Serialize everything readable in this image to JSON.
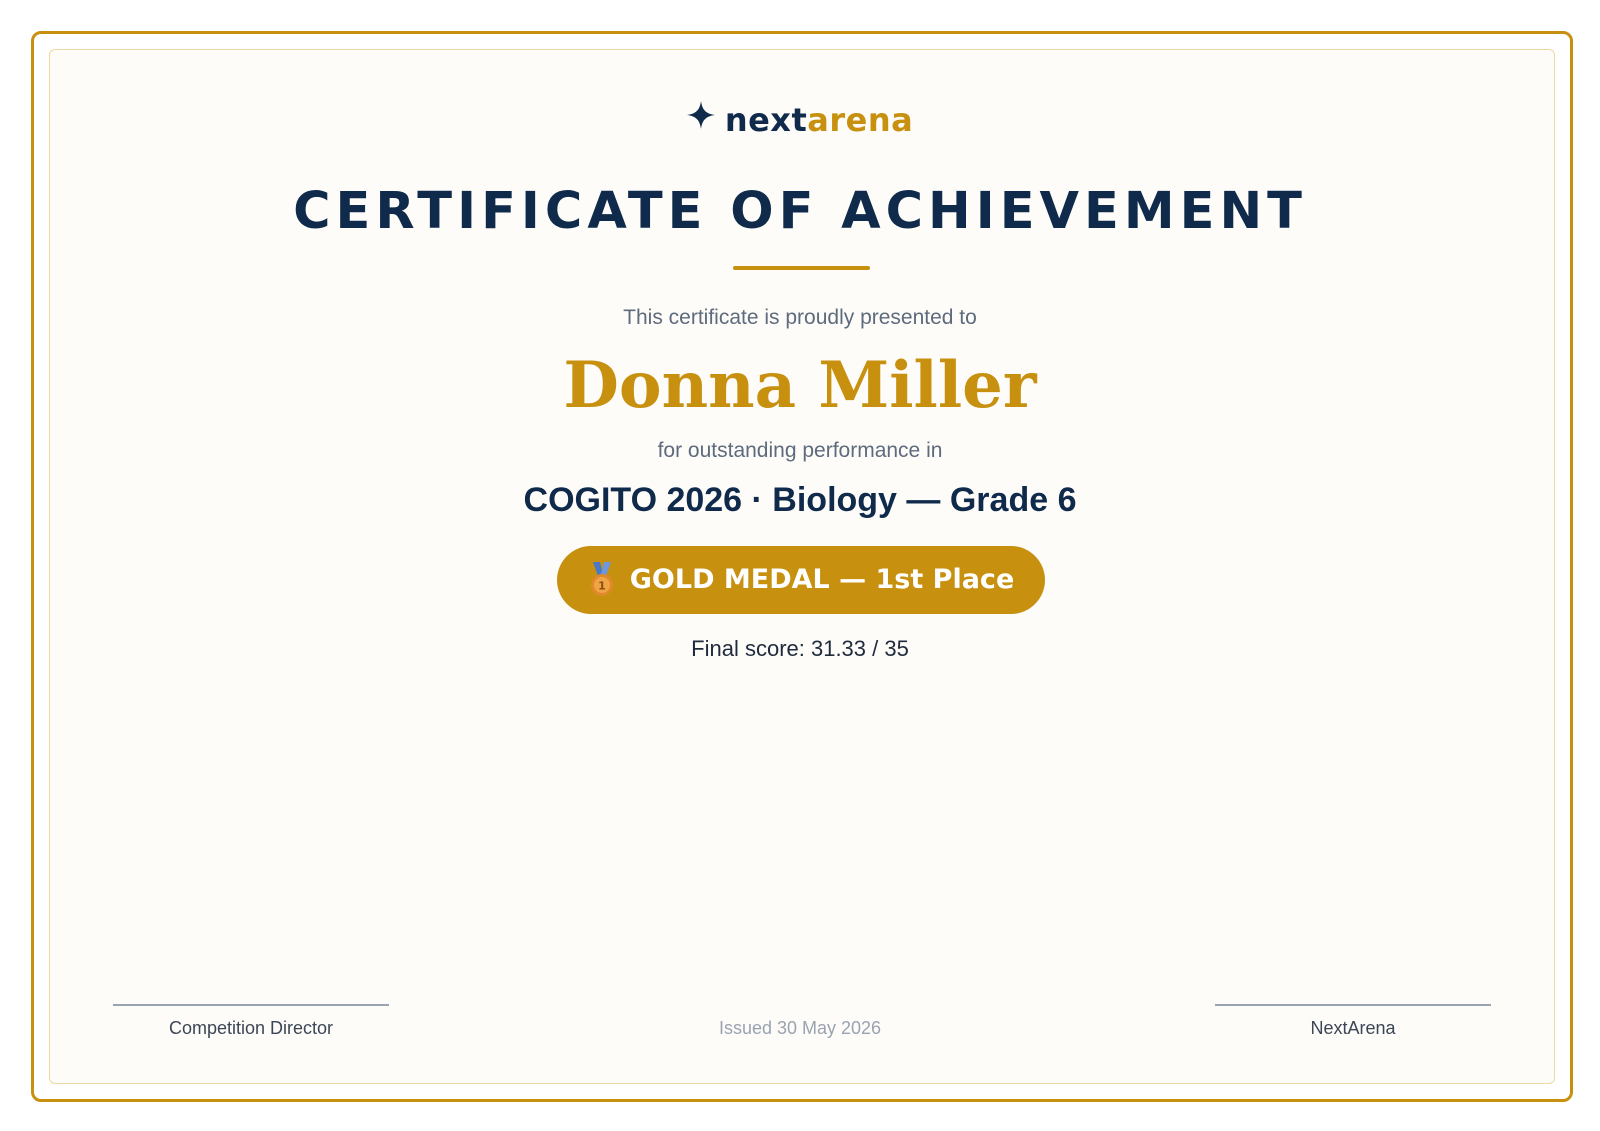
{
  "brand": {
    "name_primary": "next",
    "name_accent": "arena",
    "logo_icon": "four-point-star-icon"
  },
  "certificate": {
    "title": "CERTIFICATE OF ACHIEVEMENT",
    "presented_text": "This certificate is proudly presented to",
    "recipient_name": "Donna Miller",
    "performance_text": "for outstanding performance in",
    "event": "COGITO 2026 · Biology — Grade 6",
    "badge": {
      "icon": "medal-icon",
      "label": "GOLD MEDAL — 1st Place"
    },
    "score": "Final score: 31.33 / 35"
  },
  "footer": {
    "left_signature": "Competition Director",
    "issued": "Issued 30 May 2026",
    "right_signature": "NextArena"
  },
  "colors": {
    "navy": "#0f2a4a",
    "gold": "#c8900f",
    "muted_text": "#5e6b7d",
    "background": "#fdfcf9"
  }
}
